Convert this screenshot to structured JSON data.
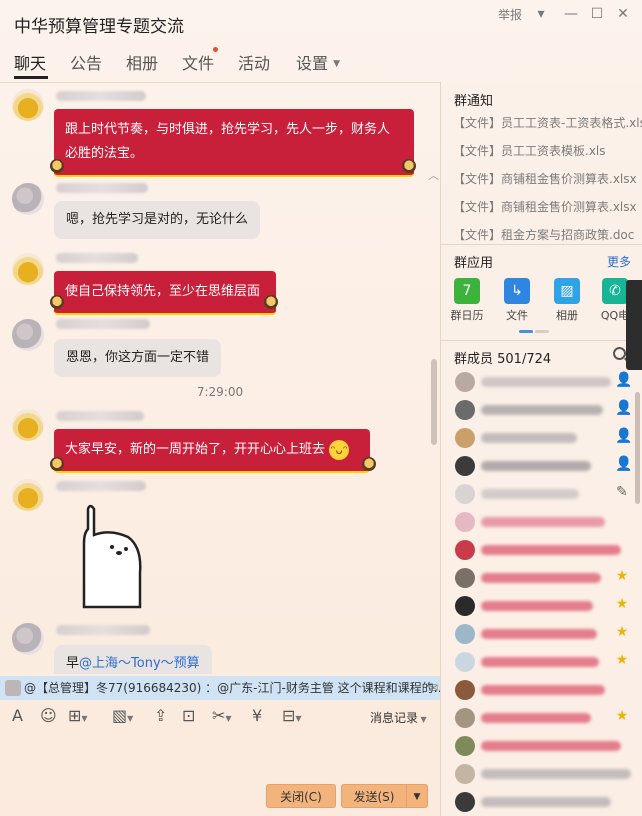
{
  "window": {
    "title": "中华预算管理专题交流",
    "report_label": "举报",
    "controls": [
      "▾",
      "—",
      "☐",
      "✕"
    ]
  },
  "tabs": [
    {
      "label": "聊天",
      "active": true
    },
    {
      "label": "公告"
    },
    {
      "label": "相册"
    },
    {
      "label": "文件",
      "has_dot": true
    },
    {
      "label": "活动"
    },
    {
      "label": "设置",
      "dropdown": true
    }
  ],
  "chat": {
    "messages": [
      {
        "type": "red",
        "text_line1": "跟上时代节奏，与时俱进，抢先学习，先人一步，财务人",
        "text_line2": "必胜的法宝。"
      },
      {
        "type": "gray",
        "text": "嗯，抢先学习是对的，无论什么"
      },
      {
        "type": "red",
        "text": "使自己保持领先，至少在思维层面"
      },
      {
        "type": "gray",
        "text": "恩恩，你这方面一定不错"
      },
      {
        "type": "time",
        "text": "7:29:00"
      },
      {
        "type": "red",
        "text": "大家早安，新的一周开始了，开开心心上班去"
      },
      {
        "type": "sticker",
        "description": "raised-finger-sticker"
      },
      {
        "type": "gray",
        "prefix": "早",
        "mention": "@上海～Tony～预算"
      }
    ],
    "emoji_smile": "😁"
  },
  "notice_bar": {
    "text": "@【总管理】冬77(916684230) ：@广东-江门-财务主管 这个课程和课程的…"
  },
  "toolbar": {
    "tools": [
      "font-icon",
      "emoji-icon",
      "gift-icon",
      "image-icon",
      "upload-icon",
      "apps-icon",
      "screenshot-icon",
      "red-packet-icon",
      "more-icon"
    ],
    "history_label": "消息记录"
  },
  "buttons": {
    "close_label": "关闭(C)",
    "send_label": "发送(S)"
  },
  "right_panel": {
    "notice_title": "群通知",
    "files": [
      "【文件】员工工资表-工资表格式.xls",
      "【文件】员工工资表模板.xls",
      "【文件】商铺租金售价测算表.xlsx",
      "【文件】商铺租金售价测算表.xlsx",
      "【文件】租金方案与招商政策.doc"
    ],
    "apps_title": "群应用",
    "apps_more": "更多",
    "apps": [
      {
        "label": "群日历",
        "icon": "calendar-icon",
        "color": "#3cb33a",
        "glyph": "7"
      },
      {
        "label": "文件",
        "icon": "file-icon",
        "color": "#2f86e0",
        "glyph": "↳"
      },
      {
        "label": "相册",
        "icon": "album-icon",
        "color": "#2fa2e8",
        "glyph": "▨"
      },
      {
        "label": "QQ电",
        "icon": "phone-icon",
        "color": "#16b596",
        "glyph": "✆"
      }
    ],
    "members_title": "群成员 501/724",
    "members": [
      {
        "role": "owner",
        "av": "#b9a9a3"
      },
      {
        "role": "admin",
        "av": "#6b6b6b"
      },
      {
        "role": "admin",
        "av": "#c9a06a"
      },
      {
        "role": "admin",
        "av": "#3b3b3b"
      },
      {
        "role": "edit",
        "av": "#d9d4d4"
      },
      {
        "role": "",
        "av": "#e4b9c4"
      },
      {
        "role": "",
        "av": "#c73b4b"
      },
      {
        "role": "star",
        "av": "#7a7068"
      },
      {
        "role": "star",
        "av": "#2a2a2a"
      },
      {
        "role": "star",
        "av": "#9cb7c9"
      },
      {
        "role": "star",
        "av": "#cbd6e2"
      },
      {
        "role": "",
        "av": "#8a5a3a"
      },
      {
        "role": "star",
        "av": "#a39582"
      },
      {
        "role": "",
        "av": "#7f8a5a"
      },
      {
        "role": "",
        "av": "#c4b4a4"
      },
      {
        "role": "",
        "av": "#3a3a3a"
      }
    ]
  },
  "colors": {
    "red_bubble": "#c8203a",
    "gray_bubble": "#e9e4e1",
    "send_button": "#f2b47c",
    "link_blue": "#2a6fd3"
  }
}
